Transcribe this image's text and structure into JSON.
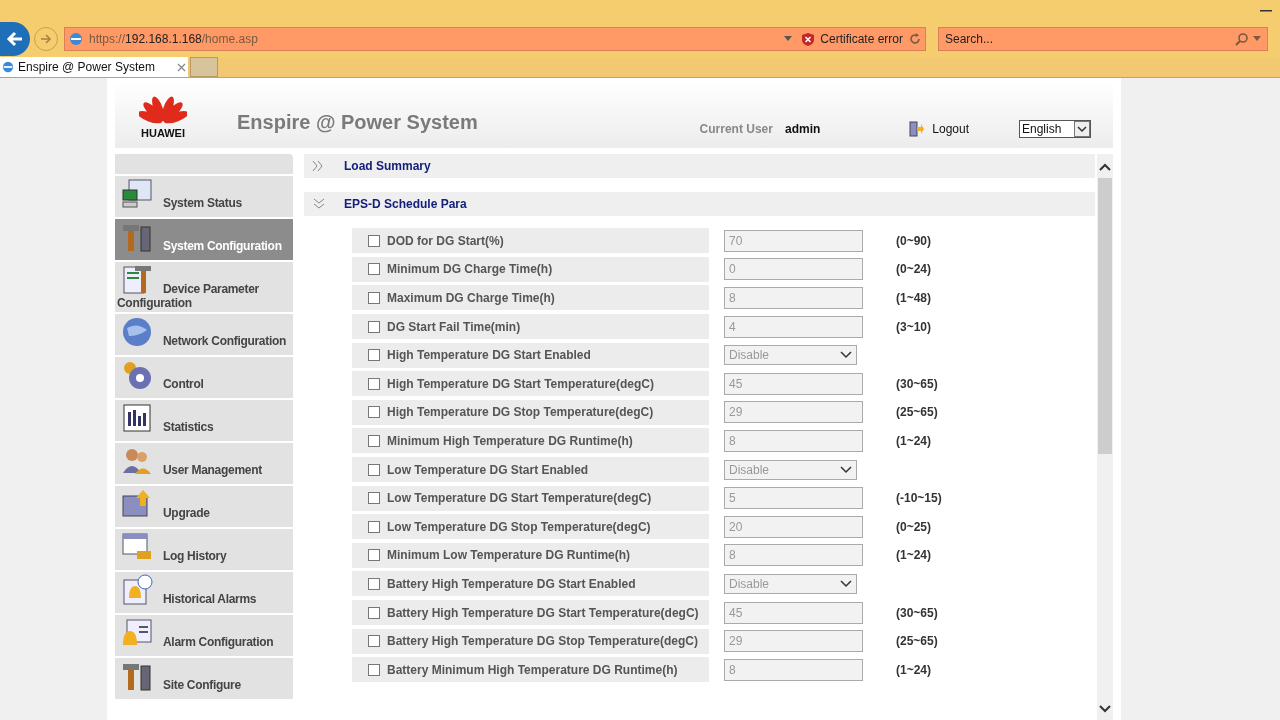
{
  "browser": {
    "address": {
      "scheme": "https://",
      "host": "192.168.1.168",
      "path": "/home.asp"
    },
    "certificate_error": "Certificate error",
    "search": {
      "placeholder": "Search..."
    },
    "tabs": [
      {
        "label": "Enspire @ Power System",
        "selected": true
      }
    ]
  },
  "header": {
    "logo_text": "HUAWEI",
    "title": "Enspire @ Power System",
    "current_user_label": "Current User",
    "current_user": "admin",
    "logout": "Logout",
    "language": "English"
  },
  "sidebar": {
    "items": [
      {
        "label": "System Status",
        "selected": false
      },
      {
        "label": "System Configuration",
        "selected": true
      },
      {
        "label": "Device Parameter Configuration",
        "selected": false
      },
      {
        "label": "Network Configuration",
        "selected": false
      },
      {
        "label": "Control",
        "selected": false
      },
      {
        "label": "Statistics",
        "selected": false
      },
      {
        "label": "User Management",
        "selected": false
      },
      {
        "label": "Upgrade",
        "selected": false
      },
      {
        "label": "Log History",
        "selected": false
      },
      {
        "label": "Historical Alarms",
        "selected": false
      },
      {
        "label": "Alarm Configuration",
        "selected": false
      },
      {
        "label": "Site Configure",
        "selected": false
      }
    ]
  },
  "sections": [
    {
      "title": "Load Summary",
      "expanded": false
    },
    {
      "title": "EPS-D Schedule Para",
      "expanded": true
    }
  ],
  "params": [
    {
      "kind": "input",
      "label": "DOD for DG Start(%)",
      "checked": false,
      "value": "70",
      "range": "(0~90)"
    },
    {
      "kind": "input",
      "label": "Minimum DG Charge Time(h)",
      "checked": false,
      "value": "0",
      "range": "(0~24)"
    },
    {
      "kind": "input",
      "label": "Maximum DG Charge Time(h)",
      "checked": false,
      "value": "8",
      "range": "(1~48)"
    },
    {
      "kind": "input",
      "label": "DG Start Fail Time(min)",
      "checked": false,
      "value": "4",
      "range": "(3~10)"
    },
    {
      "kind": "select",
      "label": "High Temperature DG Start Enabled",
      "checked": false,
      "value": "Disable"
    },
    {
      "kind": "input",
      "label": "High Temperature DG Start Temperature(degC)",
      "checked": false,
      "value": "45",
      "range": "(30~65)"
    },
    {
      "kind": "input",
      "label": "High Temperature DG Stop Temperature(degC)",
      "checked": false,
      "value": "29",
      "range": "(25~65)"
    },
    {
      "kind": "input",
      "label": "Minimum High Temperature DG Runtime(h)",
      "checked": false,
      "value": "8",
      "range": "(1~24)"
    },
    {
      "kind": "select",
      "label": "Low Temperature DG Start Enabled",
      "checked": false,
      "value": "Disable"
    },
    {
      "kind": "input",
      "label": "Low Temperature DG Start Temperature(degC)",
      "checked": false,
      "value": "5",
      "range": "(-10~15)"
    },
    {
      "kind": "input",
      "label": "Low Temperature DG Stop Temperature(degC)",
      "checked": false,
      "value": "20",
      "range": "(0~25)"
    },
    {
      "kind": "input",
      "label": "Minimum Low Temperature DG Runtime(h)",
      "checked": false,
      "value": "8",
      "range": "(1~24)"
    },
    {
      "kind": "select",
      "label": "Battery High Temperature DG Start Enabled",
      "checked": false,
      "value": "Disable"
    },
    {
      "kind": "input",
      "label": "Battery High Temperature DG Start Temperature(degC)",
      "checked": false,
      "value": "45",
      "range": "(30~65)"
    },
    {
      "kind": "input",
      "label": "Battery High Temperature DG Stop Temperature(degC)",
      "checked": false,
      "value": "29",
      "range": "(25~65)"
    },
    {
      "kind": "input",
      "label": "Battery Minimum High Temperature DG Runtime(h)",
      "checked": false,
      "value": "8",
      "range": "(1~24)"
    }
  ]
}
